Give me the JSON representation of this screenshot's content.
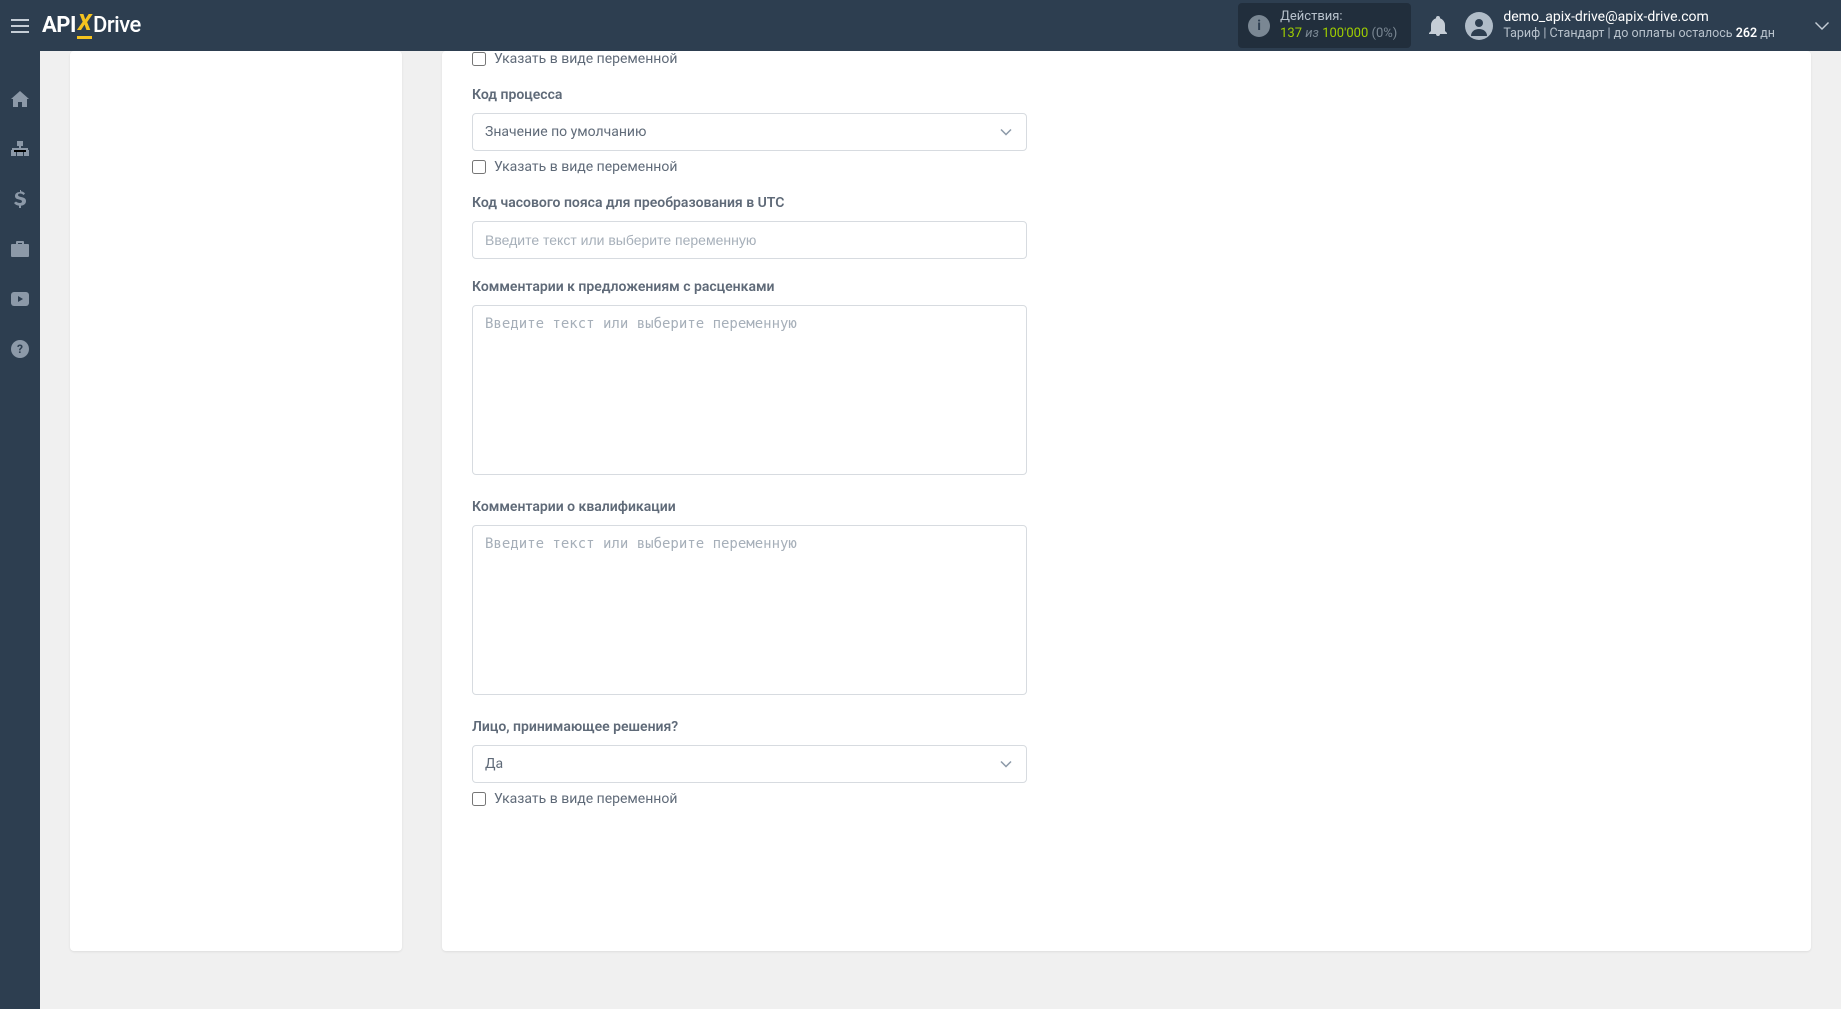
{
  "header": {
    "logo": {
      "part1": "API",
      "part2": "X",
      "part3": "Drive"
    },
    "actions": {
      "label": "Действия:",
      "used": "137",
      "of_word": "из",
      "limit": "100'000",
      "percent": "(0%)"
    },
    "user": {
      "email": "demo_apix-drive@apix-drive.com",
      "tariff_prefix": "Тариф | Стандарт | до оплаты осталось ",
      "days": "262",
      "days_suffix": " дн"
    }
  },
  "sidebar": {
    "items": [
      {
        "name": "home-icon"
      },
      {
        "name": "connections-icon"
      },
      {
        "name": "dollar-icon"
      },
      {
        "name": "briefcase-icon"
      },
      {
        "name": "youtube-icon"
      },
      {
        "name": "help-icon"
      }
    ]
  },
  "form": {
    "checkbox_var_label": "Указать в виде переменной",
    "placeholder_text": "Введите текст или выберите переменную",
    "fields": {
      "first_checkbox": "Указать в виде переменной",
      "process_code": {
        "label": "Код процесса",
        "value": "Значение по умолчанию"
      },
      "timezone_code": {
        "label": "Код часового пояса для преобразования в UTC"
      },
      "quote_comments": {
        "label": "Комментарии к предложениям с расценками"
      },
      "qualification_comments": {
        "label": "Комментарии о квалификации"
      },
      "decision_maker": {
        "label": "Лицо, принимающее решения?",
        "value": "Да"
      }
    }
  }
}
